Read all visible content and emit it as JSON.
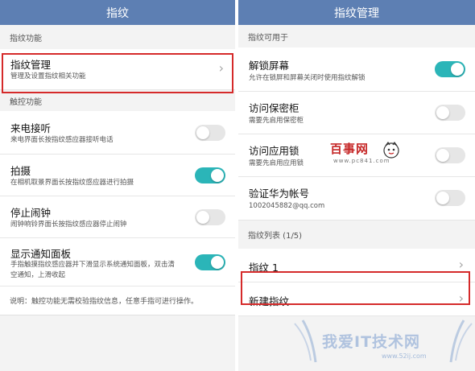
{
  "left": {
    "title": "指纹",
    "section_fingerprint": "指纹功能",
    "manage": {
      "title": "指纹管理",
      "subtitle": "管理及设置指纹相关功能"
    },
    "section_touch": "触控功能",
    "items": [
      {
        "title": "来电接听",
        "subtitle": "来电界面长按指纹感应器接听电话",
        "toggle": "off"
      },
      {
        "title": "拍摄",
        "subtitle": "在相机取景界面长按指纹感应器进行拍摄",
        "toggle": "on"
      },
      {
        "title": "停止闹钟",
        "subtitle": "闹钟响铃界面长按指纹感应器停止闹钟",
        "toggle": "off"
      },
      {
        "title": "显示通知面板",
        "subtitle_line1": "手指触摸指纹感应器并下滑显示系统通知面板，双击清",
        "subtitle_line2": "空通知，上滑收起",
        "toggle": "on"
      }
    ],
    "note": "说明：触控功能无需校验指纹信息，任意手指可进行操作。"
  },
  "right": {
    "title": "指纹管理",
    "section_usage": "指纹可用于",
    "items": [
      {
        "title": "解锁屏幕",
        "subtitle": "允许在锁屏和屏幕关闭时使用指纹解锁",
        "toggle": "on"
      },
      {
        "title": "访问保密柜",
        "subtitle": "需要先启用保密柜",
        "toggle": "off"
      },
      {
        "title": "访问应用锁",
        "subtitle": "需要先启用应用锁",
        "toggle": "off"
      },
      {
        "title": "验证华为帐号",
        "subtitle": "1002045882@qq.com",
        "toggle": "off"
      }
    ],
    "section_list": "指纹列表 (1/5)",
    "fingerprint1": "指纹 1",
    "new_fingerprint": "新建指纹"
  },
  "watermark": {
    "logo_text": "百事网",
    "logo_url": "www.pc841.com",
    "site_text": "我爱IT技术网",
    "site_url": "www.52ij.com"
  },
  "colors": {
    "titlebar": "#5d7fb3",
    "toggle_on": "#2bb5b8",
    "toggle_off": "#e6e6e6",
    "highlight": "#d52a2a"
  }
}
